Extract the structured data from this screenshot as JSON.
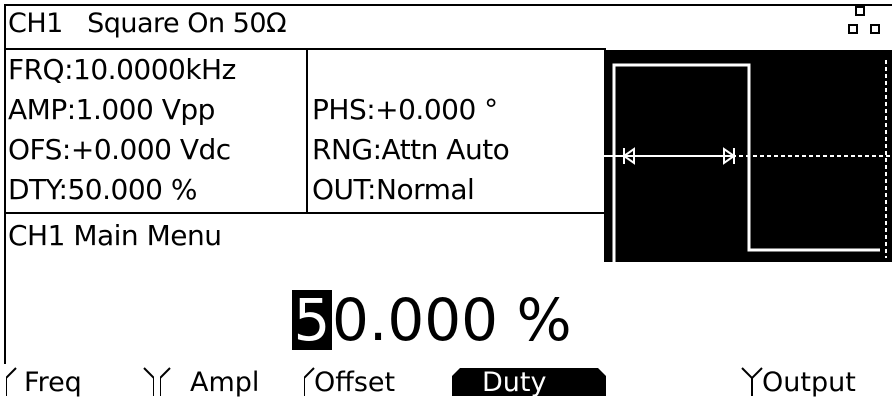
{
  "header": {
    "title": "CH1   Square On 50Ω",
    "icon": "channel-grid-icon"
  },
  "params_left": [
    "FRQ:10.0000kHz",
    "AMP:1.000 Vpp",
    "OFS:+0.000 Vdc",
    "DTY:50.000 %"
  ],
  "params_right": [
    "PHS:+0.000 °",
    "RNG:Attn Auto",
    "OUT:Normal"
  ],
  "menu_title": "CH1 Main Menu",
  "edit": {
    "cursor_digit": "5",
    "rest": "0.000 %"
  },
  "softkeys": [
    {
      "label": "Freq",
      "selected": false
    },
    {
      "label": "Ampl",
      "selected": false
    },
    {
      "label": "Offset",
      "selected": false
    },
    {
      "label": "Duty",
      "selected": true
    },
    {
      "label": "",
      "selected": false
    },
    {
      "label": "Output",
      "selected": false
    }
  ],
  "waveform": {
    "type": "square",
    "duty_fraction": 0.5
  },
  "colors": {
    "foreground": "#000000",
    "background": "#ffffff"
  }
}
